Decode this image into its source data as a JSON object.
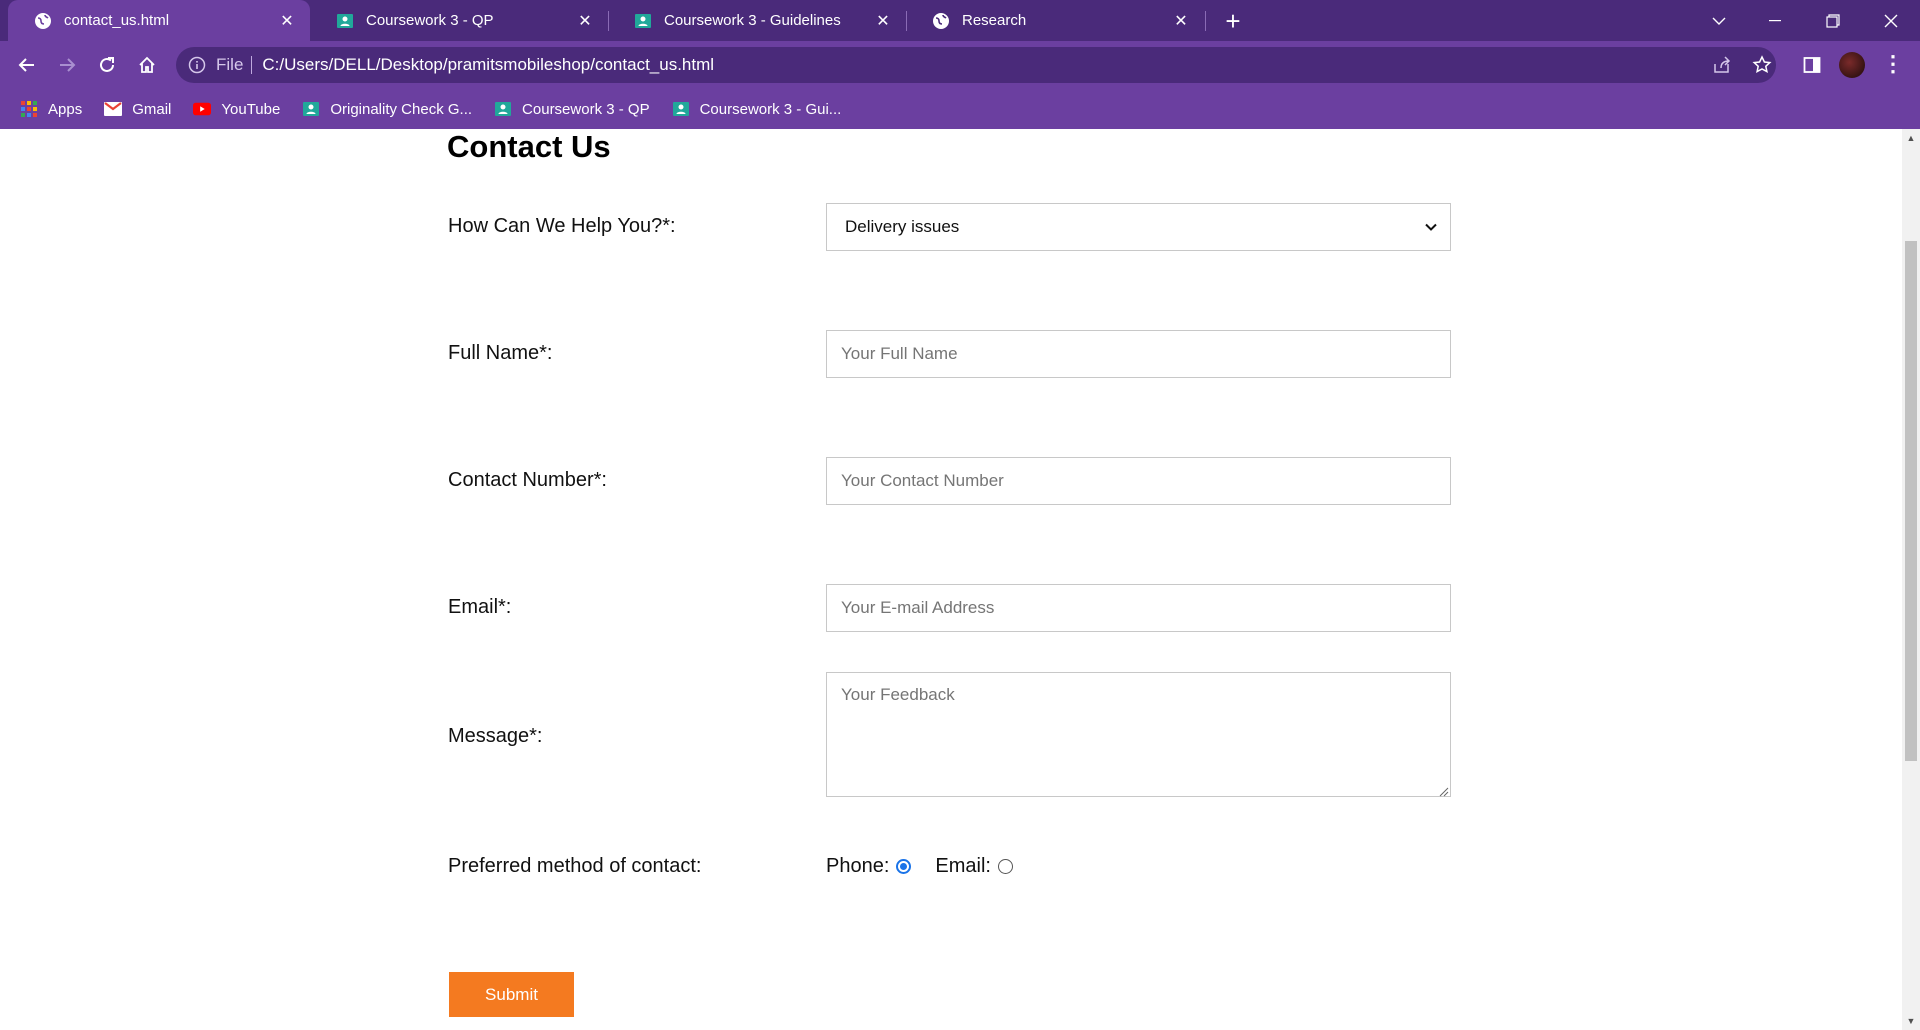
{
  "browser": {
    "tabs": [
      {
        "title": "contact_us.html",
        "icon": "globe-icon",
        "active": true
      },
      {
        "title": "Coursework 3 - QP",
        "icon": "classroom-icon",
        "active": false
      },
      {
        "title": "Coursework 3 - Guidelines",
        "icon": "classroom-icon",
        "active": false
      },
      {
        "title": "Research",
        "icon": "globe-icon",
        "active": false
      }
    ],
    "address": {
      "scheme": "File",
      "url": "C:/Users/DELL/Desktop/pramitsmobileshop/contact_us.html"
    },
    "bookmarks": [
      {
        "label": "Apps",
        "icon": "apps-grid-icon"
      },
      {
        "label": "Gmail",
        "icon": "gmail-icon"
      },
      {
        "label": "YouTube",
        "icon": "youtube-icon"
      },
      {
        "label": "Originality Check G...",
        "icon": "classroom-icon"
      },
      {
        "label": "Coursework 3 - QP",
        "icon": "classroom-icon"
      },
      {
        "label": "Coursework 3 - Gui...",
        "icon": "classroom-icon"
      }
    ],
    "colors": {
      "frame": "#4a2a7a",
      "toolbar": "#6b3fa0"
    }
  },
  "form": {
    "heading": "Contact Us",
    "help": {
      "label": "How Can We Help You?*:",
      "selected": "Delivery issues"
    },
    "full_name": {
      "label": "Full Name*:",
      "placeholder": "Your Full Name"
    },
    "contact_number": {
      "label": "Contact Number*:",
      "placeholder": "Your Contact Number"
    },
    "email": {
      "label": "Email*:",
      "placeholder": "Your E-mail Address"
    },
    "message": {
      "label": "Message*:",
      "placeholder": "Your Feedback"
    },
    "preferred": {
      "label": "Preferred method of contact:",
      "options": [
        {
          "label": "Phone:",
          "checked": true
        },
        {
          "label": "Email:",
          "checked": false
        }
      ]
    },
    "submit_label": "Submit",
    "colors": {
      "submit": "#f47a20",
      "radio_checked": "#1a73e8"
    }
  }
}
